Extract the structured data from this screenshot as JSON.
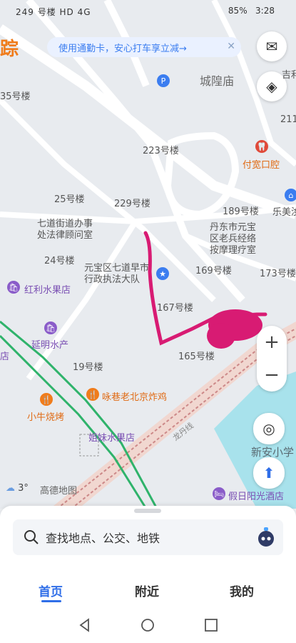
{
  "status_bar": {
    "left": "249 号楼  HD 4G",
    "battery": "85%",
    "time": "3:28"
  },
  "brand_fragment": "踪",
  "promo_banner": "使用通勤卡，安心打车享立减→",
  "pois": {
    "chenghuangmiao": "城隍庙",
    "ji": "吉利",
    "b35": "35号楼",
    "b211": "211",
    "b223": "223号楼",
    "fukuan": "付宽口腔",
    "b25": "25号楼",
    "b229": "229号楼",
    "b189": "189号楼",
    "lemei": "乐美汝",
    "qidao": "七道街道办事\n处法律顾问室",
    "dandong": "丹东市元宝\n区老兵经络\n按摩理疗室",
    "b24": "24号楼",
    "b169": "169号楼",
    "b173": "173号楼",
    "yuanbao": "元宝区七道早市\n行政执法大队",
    "hongli": "红利水果店",
    "b167": "167号楼",
    "yanming": "延明水产",
    "b165": "165号楼",
    "dian": "店",
    "b19": "19号楼",
    "yongxiang": "咏巷老北京炸鸡",
    "xiaoniu": "小牛烧烤",
    "jiemei": "姐妹水果店",
    "xinan": "新安小学",
    "jiari": "假日阳光酒店",
    "road": "龙丹线"
  },
  "weather": "3°",
  "map_logo": "高德地图",
  "search": {
    "placeholder": "查找地点、公交、地铁"
  },
  "tabs": [
    "首页",
    "附近",
    "我的"
  ],
  "colors": {
    "accent": "#2f6ee8",
    "banner_text": "#3b7df0",
    "annotation": "#d81b73"
  }
}
